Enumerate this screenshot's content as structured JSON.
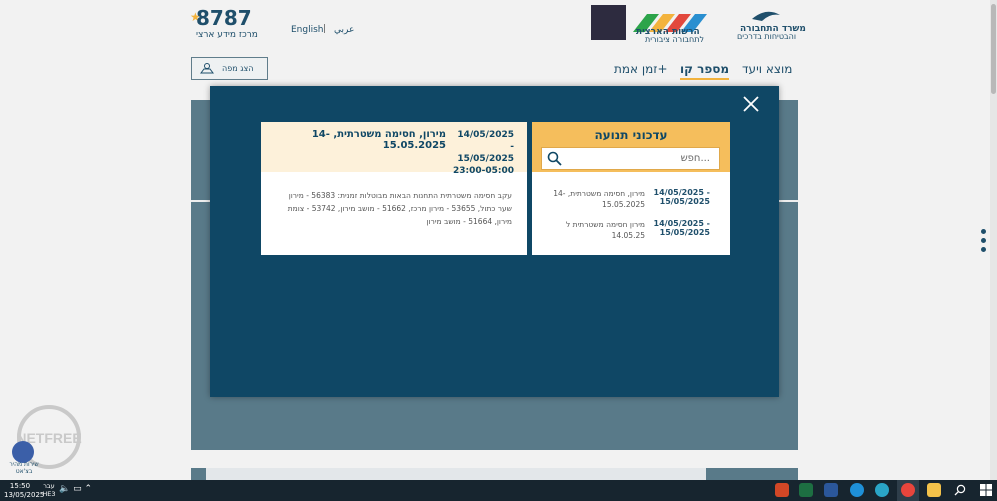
{
  "header": {
    "hotline": "8787",
    "hotline_sub": "מרכז מידע ארצי",
    "lang_en": "English",
    "lang_sep": "|",
    "lang_ar": "عربي",
    "logo_authority_line1": "הרשות הארצית",
    "logo_authority_line2": "לתחבורה ציבורית",
    "logo_ministry_line1": "משרד התחבורה",
    "logo_ministry_line2": "והבטיחות בדרכים"
  },
  "nav": {
    "map_button": "הצג מפה",
    "tabs": [
      {
        "label": "מוצא ויעד"
      },
      {
        "label": "מספר קו"
      },
      {
        "label": "זמן אמת+"
      }
    ]
  },
  "updates": {
    "title": "עדכוני תנועה",
    "search_placeholder": "חפש...",
    "items": [
      {
        "date": "14/05/2025 - 15/05/2025",
        "text": "מירון, חסימה משטרתית, 14-15.05.2025"
      },
      {
        "date": "14/05/2025 - 15/05/2025",
        "text": "מירון חסימה משטרתית ל 14.05.25"
      }
    ]
  },
  "detail": {
    "date_line1": "14/05/2025 -",
    "date_line2": "15/05/2025",
    "date_line3": "23:00-05:00",
    "title": "מירון, חסימה משטרתית, 14-15.05.2025",
    "body": "עקב חסימה משטרתית התחנות הבאות מבוטלות זמנית: 56383 - מירון שער כתול, 53655 - מירון מרכז, 51662 - מושב מירון, 53742 - צומת מירון, 51664 - מושב מירון"
  },
  "chat": {
    "label": "שירות מהיר בצ'אט"
  },
  "badge": {
    "label": "NETFREE"
  },
  "taskbar": {
    "time": "15:50",
    "date": "13/05/2025",
    "lang_top": "עבר",
    "lang_bottom": "HE3"
  },
  "colors": {
    "modal_bg": "#0f4765",
    "accent": "#f5be5c",
    "text_dark": "#1f4f6b"
  }
}
